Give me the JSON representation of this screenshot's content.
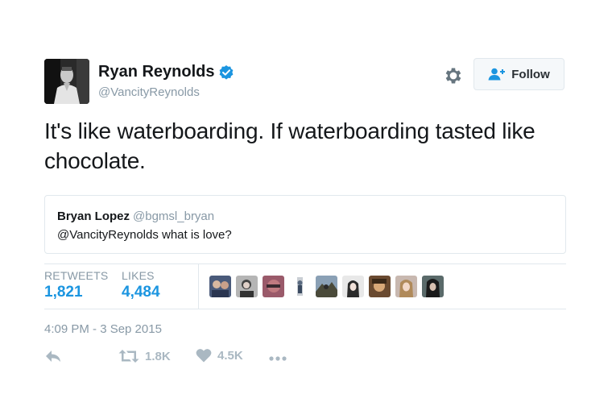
{
  "author": {
    "name": "Ryan Reynolds",
    "handle": "@VancityReynolds",
    "verified": true,
    "avatar_icon": "profile-photo"
  },
  "header": {
    "settings_icon": "gear-icon",
    "follow_label": "Follow",
    "follow_icon": "person-plus-icon"
  },
  "tweet": {
    "text": "It's like waterboarding. If waterboarding tasted like chocolate."
  },
  "quote": {
    "name": "Bryan Lopez",
    "handle": "@bgmsl_bryan",
    "text": "@VancityReynolds what is love?"
  },
  "stats": {
    "retweets_label": "RETWEETS",
    "retweets_value": "1,821",
    "likes_label": "LIKES",
    "likes_value": "4,484"
  },
  "timestamp": "4:09 PM - 3 Sep 2015",
  "actions": {
    "reply_icon": "reply-icon",
    "retweet_count": "1.8K",
    "like_count": "4.5K",
    "more_icon": "more-icon"
  },
  "colors": {
    "accent": "#1b95e0",
    "muted": "#8899a6",
    "action_gray": "#aab8c2",
    "border": "#e1e8ed"
  }
}
